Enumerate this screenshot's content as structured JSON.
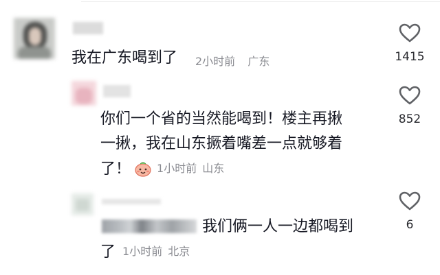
{
  "comments": [
    {
      "text": "我在广东喝到了",
      "time": "2小时前",
      "location": "广东",
      "likes": "1415",
      "like_icon": "heart-outline-icon"
    },
    {
      "text_line1": "你们一个省的当然能喝到！楼主再揪",
      "text_line2": "一揪，我在山东撅着嘴差一点就够着",
      "text_line3_prefix": "了！",
      "emoji": "peach-emoji-icon",
      "time": "1小时前",
      "location": "山东",
      "likes": "852",
      "like_icon": "heart-outline-icon"
    },
    {
      "text_line1": "我们俩一人一边都喝到",
      "text_line2_prefix": "了",
      "time": "1小时前",
      "location": "北京",
      "likes": "6",
      "like_icon": "heart-outline-icon"
    }
  ],
  "colors": {
    "text": "#161823",
    "meta": "#8a8b91",
    "heart": "#606266"
  }
}
